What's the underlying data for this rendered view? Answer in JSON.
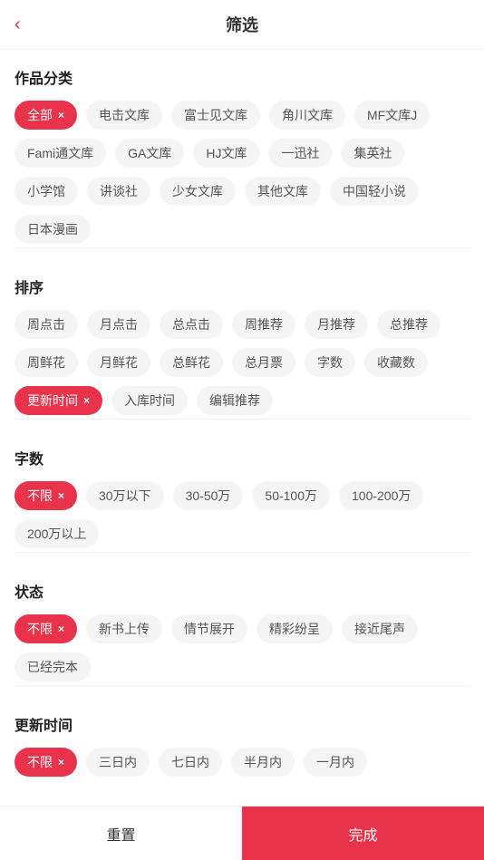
{
  "header": {
    "back_icon": "‹",
    "title": "筛选"
  },
  "sections": [
    {
      "id": "category",
      "title": "作品分类",
      "tags": [
        {
          "label": "全部",
          "active": true
        },
        {
          "label": "电击文库",
          "active": false
        },
        {
          "label": "富士见文库",
          "active": false
        },
        {
          "label": "角川文库",
          "active": false
        },
        {
          "label": "MF文库J",
          "active": false
        },
        {
          "label": "Fami通文库",
          "active": false
        },
        {
          "label": "GA文库",
          "active": false
        },
        {
          "label": "HJ文库",
          "active": false
        },
        {
          "label": "一迅社",
          "active": false
        },
        {
          "label": "集英社",
          "active": false
        },
        {
          "label": "小学馆",
          "active": false
        },
        {
          "label": "讲谈社",
          "active": false
        },
        {
          "label": "少女文库",
          "active": false
        },
        {
          "label": "其他文库",
          "active": false
        },
        {
          "label": "中国轻小说",
          "active": false
        },
        {
          "label": "日本漫画",
          "active": false
        }
      ]
    },
    {
      "id": "sort",
      "title": "排序",
      "tags": [
        {
          "label": "周点击",
          "active": false
        },
        {
          "label": "月点击",
          "active": false
        },
        {
          "label": "总点击",
          "active": false
        },
        {
          "label": "周推荐",
          "active": false
        },
        {
          "label": "月推荐",
          "active": false
        },
        {
          "label": "总推荐",
          "active": false
        },
        {
          "label": "周鲜花",
          "active": false
        },
        {
          "label": "月鲜花",
          "active": false
        },
        {
          "label": "总鲜花",
          "active": false
        },
        {
          "label": "总月票",
          "active": false
        },
        {
          "label": "字数",
          "active": false
        },
        {
          "label": "收藏数",
          "active": false
        },
        {
          "label": "更新时间",
          "active": true
        },
        {
          "label": "入库时间",
          "active": false
        },
        {
          "label": "编辑推荐",
          "active": false
        }
      ]
    },
    {
      "id": "word_count",
      "title": "字数",
      "tags": [
        {
          "label": "不限",
          "active": true
        },
        {
          "label": "30万以下",
          "active": false
        },
        {
          "label": "30-50万",
          "active": false
        },
        {
          "label": "50-100万",
          "active": false
        },
        {
          "label": "100-200万",
          "active": false
        },
        {
          "label": "200万以上",
          "active": false
        }
      ]
    },
    {
      "id": "status",
      "title": "状态",
      "tags": [
        {
          "label": "不限",
          "active": true
        },
        {
          "label": "新书上传",
          "active": false
        },
        {
          "label": "情节展开",
          "active": false
        },
        {
          "label": "精彩纷呈",
          "active": false
        },
        {
          "label": "接近尾声",
          "active": false
        },
        {
          "label": "已经完本",
          "active": false
        }
      ]
    },
    {
      "id": "update_time",
      "title": "更新时间",
      "tags": [
        {
          "label": "不限",
          "active": true
        },
        {
          "label": "三日内",
          "active": false
        },
        {
          "label": "七日内",
          "active": false
        },
        {
          "label": "半月内",
          "active": false
        },
        {
          "label": "一月内",
          "active": false
        }
      ]
    }
  ],
  "bottom": {
    "reset_label": "重置",
    "confirm_label": "完成"
  }
}
